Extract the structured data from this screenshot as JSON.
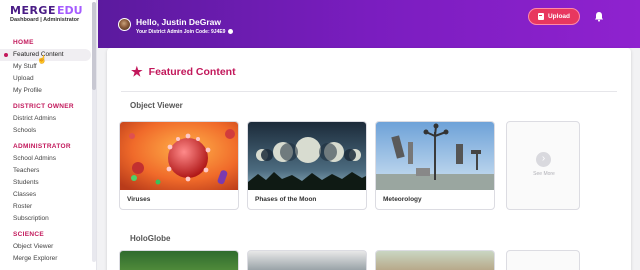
{
  "logo": {
    "merge": "MERGE",
    "edu": "EDU",
    "subtitle": "Dashboard | Administrator"
  },
  "nav": {
    "sections": [
      {
        "title": "HOME",
        "items": [
          "Featured Content",
          "My Stuff",
          "Upload",
          "My Profile"
        ]
      },
      {
        "title": "DISTRICT OWNER",
        "items": [
          "District Admins",
          "Schools"
        ]
      },
      {
        "title": "ADMINISTRATOR",
        "items": [
          "School Admins",
          "Teachers",
          "Students",
          "Classes",
          "Roster",
          "Subscription"
        ]
      },
      {
        "title": "SCIENCE",
        "items": [
          "Object Viewer",
          "Merge Explorer"
        ]
      }
    ],
    "active_item": "Featured Content"
  },
  "header": {
    "greeting": "Hello, Justin DeGraw",
    "join_code": "Your District Admin Join Code: 9J4E9",
    "upload_label": "Upload",
    "bell_icon": "bell-icon",
    "colors": {
      "gradient_start": "#5b1a9e",
      "gradient_end": "#8f22cf",
      "upload": "#e8375f"
    }
  },
  "main": {
    "title": "Featured Content",
    "title_icon": "star-icon",
    "accent": "#c2185b",
    "sections": [
      {
        "title": "Object Viewer",
        "cards": [
          "Viruses",
          "Phases of the Moon",
          "Meteorology"
        ],
        "see_more": "See More"
      },
      {
        "title": "HoloGlobe"
      }
    ]
  }
}
